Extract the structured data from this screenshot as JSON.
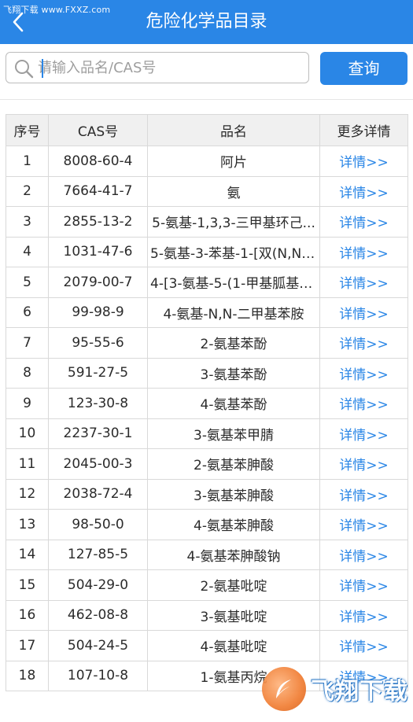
{
  "header": {
    "watermark_top": "飞翔下载 www.FXXZ.com",
    "title": "危险化学品目录",
    "back_icon": "chevron-left-icon",
    "bg_color": "#2a86e6"
  },
  "search": {
    "placeholder": "请输入品名/CAS号",
    "value": "",
    "button_label": "查询",
    "icon": "search-icon"
  },
  "table": {
    "headers": [
      "序号",
      "CAS号",
      "品名",
      "更多详情"
    ],
    "rows": [
      {
        "no": "1",
        "cas": "8008-60-4",
        "name": "阿片",
        "detail": "详情>>"
      },
      {
        "no": "2",
        "cas": "7664-41-7",
        "name": "氨",
        "detail": "详情>>"
      },
      {
        "no": "3",
        "cas": "2855-13-2",
        "name": "5-氨基-1,3,3-三甲基环己...",
        "detail": "详情>>"
      },
      {
        "no": "4",
        "cas": "1031-47-6",
        "name": "5-氨基-3-苯基-1-[双(N,N-...",
        "detail": "详情>>"
      },
      {
        "no": "5",
        "cas": "2079-00-7",
        "name": "4-[3-氨基-5-(1-甲基胍基)...",
        "detail": "详情>>"
      },
      {
        "no": "6",
        "cas": "99-98-9",
        "name": "4-氨基-N,N-二甲基苯胺",
        "detail": "详情>>"
      },
      {
        "no": "7",
        "cas": "95-55-6",
        "name": "2-氨基苯酚",
        "detail": "详情>>"
      },
      {
        "no": "8",
        "cas": "591-27-5",
        "name": "3-氨基苯酚",
        "detail": "详情>>"
      },
      {
        "no": "9",
        "cas": "123-30-8",
        "name": "4-氨基苯酚",
        "detail": "详情>>"
      },
      {
        "no": "10",
        "cas": "2237-30-1",
        "name": "3-氨基苯甲腈",
        "detail": "详情>>"
      },
      {
        "no": "11",
        "cas": "2045-00-3",
        "name": "2-氨基苯胂酸",
        "detail": "详情>>"
      },
      {
        "no": "12",
        "cas": "2038-72-4",
        "name": "3-氨基苯胂酸",
        "detail": "详情>>"
      },
      {
        "no": "13",
        "cas": "98-50-0",
        "name": "4-氨基苯胂酸",
        "detail": "详情>>"
      },
      {
        "no": "14",
        "cas": "127-85-5",
        "name": "4-氨基苯胂酸钠",
        "detail": "详情>>"
      },
      {
        "no": "15",
        "cas": "504-29-0",
        "name": "2-氨基吡啶",
        "detail": "详情>>"
      },
      {
        "no": "16",
        "cas": "462-08-8",
        "name": "3-氨基吡啶",
        "detail": "详情>>"
      },
      {
        "no": "17",
        "cas": "504-24-5",
        "name": "4-氨基吡啶",
        "detail": "详情>>"
      },
      {
        "no": "18",
        "cas": "107-10-8",
        "name": "1-氨基丙烷",
        "detail": "详情>>"
      }
    ]
  },
  "watermark_logo": {
    "text": "飞翔下载",
    "icon": "feather-logo-icon"
  }
}
